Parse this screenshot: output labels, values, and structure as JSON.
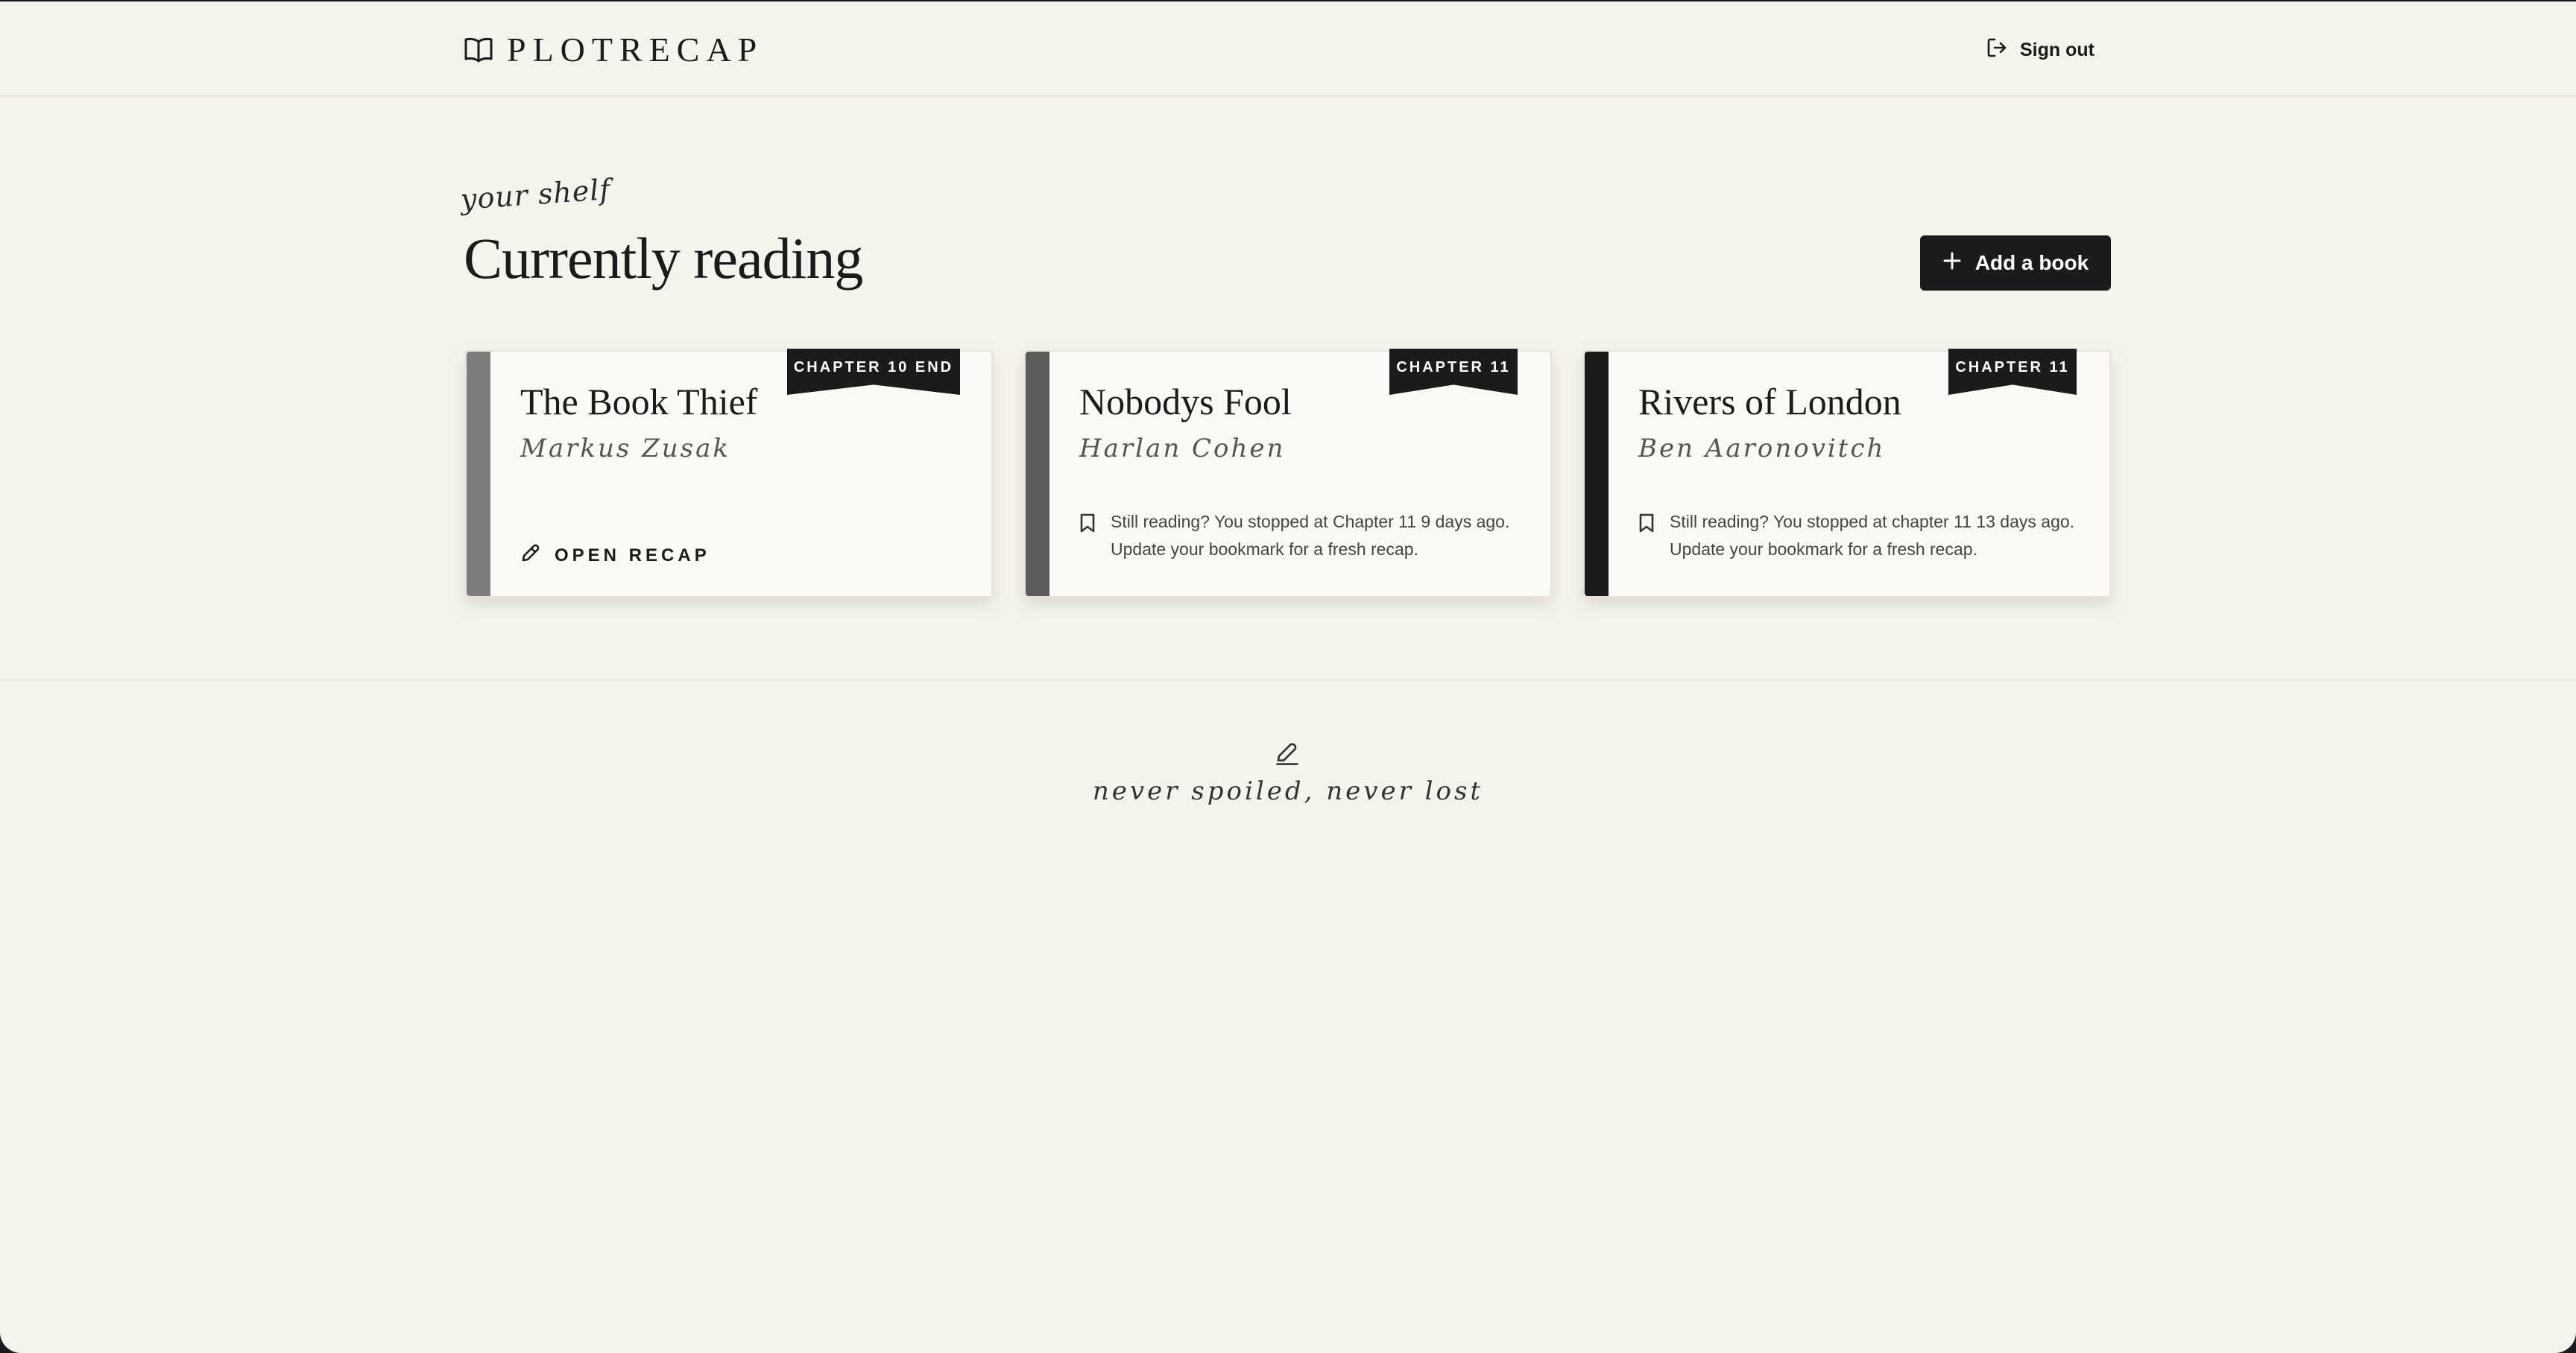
{
  "header": {
    "logo_text": "PLOTRECAP",
    "signout_label": "Sign out"
  },
  "shelf": {
    "eyebrow": "your shelf",
    "title": "Currently reading",
    "add_button_label": "Add a book"
  },
  "books": [
    {
      "title": "The Book Thief",
      "author": "Markus Zusak",
      "ribbon": "CHAPTER 10 END",
      "spine_color": "#7d7d7d",
      "action_label": "OPEN RECAP"
    },
    {
      "title": "Nobodys Fool",
      "author": "Harlan Cohen",
      "ribbon": "CHAPTER 11",
      "spine_color": "#5c5c5c",
      "note": "Still reading? You stopped at Chapter 11 9 days ago. Update your bookmark for a fresh recap."
    },
    {
      "title": "Rivers of London",
      "author": "Ben Aaronovitch",
      "ribbon": "CHAPTER 11",
      "spine_color": "#1b1b1b",
      "note": "Still reading? You stopped at chapter 11 13 days ago. Update your bookmark for a fresh recap."
    }
  ],
  "footer": {
    "tagline": "never spoiled, never lost"
  },
  "colors": {
    "background": "#f4f3ec",
    "card": "#faf9f6",
    "ink": "#1b1b1b"
  }
}
